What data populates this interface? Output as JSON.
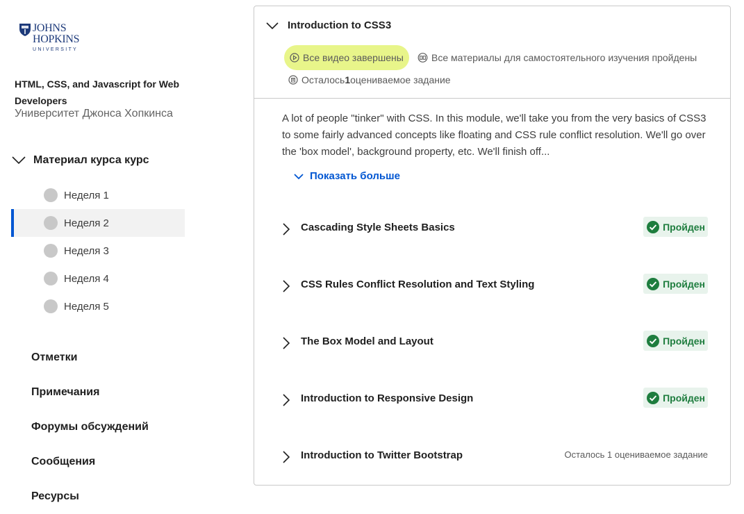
{
  "sidebar": {
    "logo": {
      "line1": "JOHNS",
      "line2": "HOPKINS",
      "line3": "UNIVERSITY",
      "icon": "shield-icon",
      "color": "#1d3a7a"
    },
    "course_title": "HTML, CSS, and Javascript for Web Developers",
    "course_org": "Университет Джонса Хопкинса",
    "material_label": "Материал курса курс",
    "weeks": [
      {
        "label": "Неделя 1",
        "active": false
      },
      {
        "label": "Неделя 2",
        "active": true
      },
      {
        "label": "Неделя 3",
        "active": false
      },
      {
        "label": "Неделя 4",
        "active": false
      },
      {
        "label": "Неделя 5",
        "active": false
      }
    ],
    "links": [
      "Отметки",
      "Примечания",
      "Форумы обсуждений",
      "Сообщения",
      "Ресурсы"
    ]
  },
  "module": {
    "title": "Introduction to CSS3",
    "videos_status": "Все видео завершены",
    "reading_status": "Все материалы для самостоятельного изучения пройдены",
    "graded_prefix": "Осталось ",
    "graded_count": "1",
    "graded_suffix": " оцениваемое задание",
    "description": "A lot of people \"tinker\" with CSS. In this module, we'll take you from the very basics of CSS3 to some fairly advanced concepts like floating and CSS rule conflict resolution. We'll go over the 'box model', background property, etc. We'll finish off...",
    "show_more": "Показать больше",
    "lessons": [
      {
        "title": "Cascading Style Sheets Basics",
        "status": "Пройден"
      },
      {
        "title": "CSS Rules Conflict Resolution and Text Styling",
        "status": "Пройден"
      },
      {
        "title": "The Box Model and Layout",
        "status": "Пройден"
      },
      {
        "title": "Introduction to Responsive Design",
        "status": "Пройден"
      },
      {
        "title": "Introduction to Twitter Bootstrap",
        "remaining": "Осталось 1 оцениваемое задание"
      }
    ]
  },
  "colors": {
    "accent": "#0056d2",
    "highlight": "#e8f58a",
    "success": "#1e7d3e",
    "success_bg": "#e8f3ec"
  }
}
